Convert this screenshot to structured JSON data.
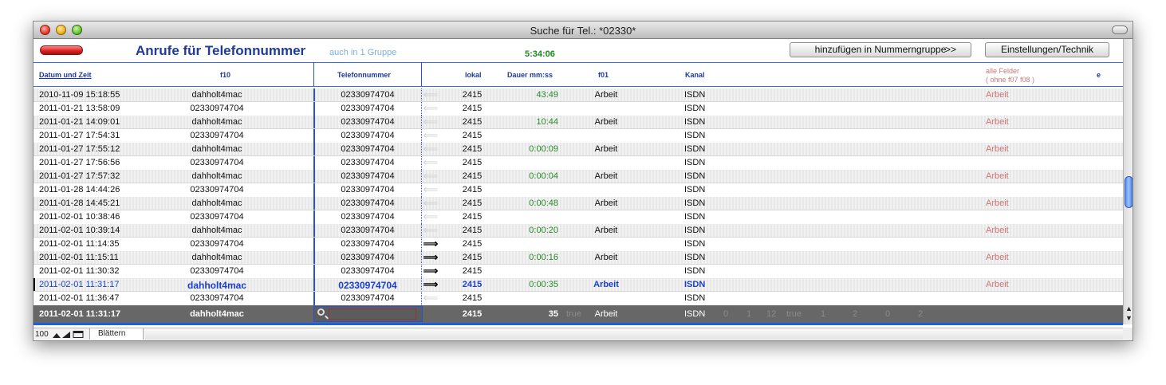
{
  "window": {
    "title": "Suche für Tel.: *02330*"
  },
  "header": {
    "title": "Anrufe für Telefonnummer",
    "group_note": "auch in 1 Gruppe",
    "clock": "5:34:06",
    "add_button": "hinzufügen in Nummerngruppe",
    "add_button_arrow": ">>",
    "settings_button": "Einstellungen/Technik"
  },
  "columns": {
    "datum": "Datum und Zeit",
    "f10": "f10",
    "telefon": "Telefonnummer",
    "lokal": "lokal",
    "dauer": "Dauer mm:ss",
    "f01": "f01",
    "kanal": "Kanal",
    "alle_1": "alle Felder",
    "alle_2": "( ohne f07 f08 )",
    "e": "e"
  },
  "rows": [
    {
      "date": "2010-11-09  15:18:55",
      "f10": "dahholt4mac",
      "tel": "02330974704",
      "dir": "in",
      "lokal": "2415",
      "dauer": "43:49",
      "f01": "Arbeit",
      "kanal": "ISDN",
      "alle": "Arbeit"
    },
    {
      "date": "2011-01-21  13:58:09",
      "f10": "02330974704",
      "tel": "02330974704",
      "dir": "in",
      "lokal": "2415",
      "dauer": "",
      "f01": "",
      "kanal": "ISDN",
      "alle": ""
    },
    {
      "date": "2011-01-21  14:09:01",
      "f10": "dahholt4mac",
      "tel": "02330974704",
      "dir": "in",
      "lokal": "2415",
      "dauer": "10:44",
      "f01": "Arbeit",
      "kanal": "ISDN",
      "alle": "Arbeit"
    },
    {
      "date": "2011-01-27  17:54:31",
      "f10": "02330974704",
      "tel": "02330974704",
      "dir": "in",
      "lokal": "2415",
      "dauer": "",
      "f01": "",
      "kanal": "ISDN",
      "alle": ""
    },
    {
      "date": "2011-01-27  17:55:12",
      "f10": "dahholt4mac",
      "tel": "02330974704",
      "dir": "in",
      "lokal": "2415",
      "dauer": "0:00:09",
      "f01": "Arbeit",
      "kanal": "ISDN",
      "alle": "Arbeit"
    },
    {
      "date": "2011-01-27  17:56:56",
      "f10": "02330974704",
      "tel": "02330974704",
      "dir": "in",
      "lokal": "2415",
      "dauer": "",
      "f01": "",
      "kanal": "ISDN",
      "alle": ""
    },
    {
      "date": "2011-01-27  17:57:32",
      "f10": "dahholt4mac",
      "tel": "02330974704",
      "dir": "in",
      "lokal": "2415",
      "dauer": "0:00:04",
      "f01": "Arbeit",
      "kanal": "ISDN",
      "alle": "Arbeit"
    },
    {
      "date": "2011-01-28  14:44:26",
      "f10": "02330974704",
      "tel": "02330974704",
      "dir": "in",
      "lokal": "2415",
      "dauer": "",
      "f01": "",
      "kanal": "ISDN",
      "alle": ""
    },
    {
      "date": "2011-01-28  14:45:21",
      "f10": "dahholt4mac",
      "tel": "02330974704",
      "dir": "in",
      "lokal": "2415",
      "dauer": "0:00:48",
      "f01": "Arbeit",
      "kanal": "ISDN",
      "alle": "Arbeit"
    },
    {
      "date": "2011-02-01  10:38:46",
      "f10": "02330974704",
      "tel": "02330974704",
      "dir": "in",
      "lokal": "2415",
      "dauer": "",
      "f01": "",
      "kanal": "ISDN",
      "alle": ""
    },
    {
      "date": "2011-02-01  10:39:14",
      "f10": "dahholt4mac",
      "tel": "02330974704",
      "dir": "in",
      "lokal": "2415",
      "dauer": "0:00:20",
      "f01": "Arbeit",
      "kanal": "ISDN",
      "alle": "Arbeit"
    },
    {
      "date": "2011-02-01  11:14:35",
      "f10": "02330974704",
      "tel": "02330974704",
      "dir": "out",
      "lokal": "2415",
      "dauer": "",
      "f01": "",
      "kanal": "ISDN",
      "alle": ""
    },
    {
      "date": "2011-02-01  11:15:11",
      "f10": "dahholt4mac",
      "tel": "02330974704",
      "dir": "out",
      "lokal": "2415",
      "dauer": "0:00:16",
      "f01": "Arbeit",
      "kanal": "ISDN",
      "alle": "Arbeit"
    },
    {
      "date": "2011-02-01  11:30:32",
      "f10": "02330974704",
      "tel": "02330974704",
      "dir": "out",
      "lokal": "2415",
      "dauer": "",
      "f01": "",
      "kanal": "ISDN",
      "alle": ""
    },
    {
      "date": "2011-02-01  11:31:17",
      "f10": "dahholt4mac",
      "tel": "02330974704",
      "dir": "out",
      "lokal": "2415",
      "dauer": "0:00:35",
      "f01": "Arbeit",
      "kanal": "ISDN",
      "alle": "Arbeit",
      "selected": true
    },
    {
      "date": "2011-02-01  11:36:47",
      "f10": "02330974704",
      "tel": "02330974704",
      "dir": "in",
      "lokal": "2415",
      "dauer": "",
      "f01": "",
      "kanal": "ISDN",
      "alle": ""
    }
  ],
  "edit_row": {
    "date": "2011-02-01  11:31:17",
    "f10": "dahholt4mac",
    "lokal": "2415",
    "dauer": "35",
    "flag": "true",
    "f01": "Arbeit",
    "kanal": "ISDN",
    "extra": [
      "0",
      "1",
      "12",
      "true",
      "1",
      "2",
      "0",
      "2"
    ]
  },
  "status": {
    "zoom": "100",
    "mode": "Blättern"
  },
  "icons": {
    "in_arrow": "⟸",
    "out_arrow": "⟹",
    "search": "search-icon"
  },
  "colors": {
    "accent": "#1e3a9a",
    "duration": "#2a8a2a",
    "alle": "#cc7777",
    "selection": "#1a3fd0",
    "edit_row_bg": "#676767"
  }
}
